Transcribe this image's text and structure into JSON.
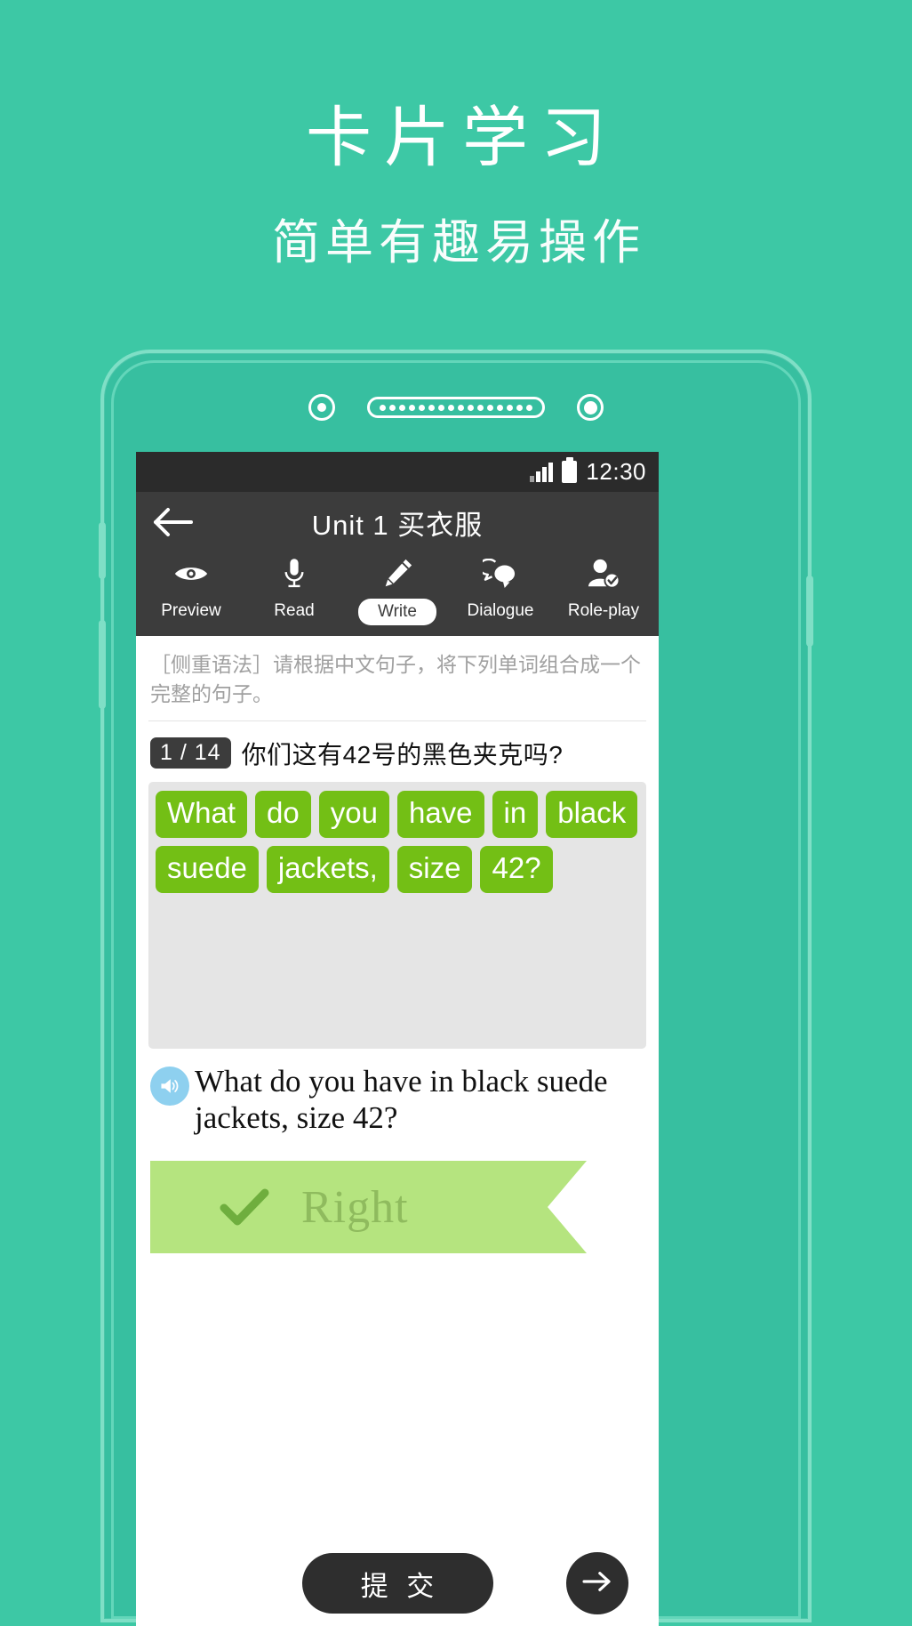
{
  "promo": {
    "title": "卡片学习",
    "subtitle": "简单有趣易操作"
  },
  "colors": {
    "background": "#3dc8a5",
    "tile_green": "#73bf15",
    "ribbon_green": "#b5e47f",
    "ribbon_text": "#8fbb5e",
    "speaker_blue": "#8ed0ef",
    "dark_bar": "#3c3c3c",
    "status_bar": "#2b2b2b"
  },
  "statusbar": {
    "time": "12:30",
    "signal_icon": "signal-bars-icon",
    "battery_icon": "battery-icon"
  },
  "titlebar": {
    "back_icon": "back-arrow-icon",
    "title": "Unit 1 买衣服"
  },
  "tabs": [
    {
      "label": "Preview",
      "icon": "eye-icon",
      "active": false
    },
    {
      "label": "Read",
      "icon": "microphone-icon",
      "active": false
    },
    {
      "label": "Write",
      "icon": "pencil-icon",
      "active": true
    },
    {
      "label": "Dialogue",
      "icon": "speech-bubbles-icon",
      "active": false
    },
    {
      "label": "Role-play",
      "icon": "person-check-icon",
      "active": false
    }
  ],
  "content": {
    "instruction": "［侧重语法］请根据中文句子，将下列单词组合成一个完整的句子。",
    "question_badge": "1 / 14",
    "question_text": "你们这有42号的黑色夹克吗?",
    "word_tiles": [
      "What",
      "do",
      "you",
      "have",
      "in",
      "black",
      "suede",
      "jackets,",
      "size",
      "42?"
    ],
    "speaker_icon": "speaker-icon",
    "answer_sentence": "What do you have in black suede jackets, size 42?",
    "result": {
      "check_icon": "check-icon",
      "label": "Right"
    }
  },
  "bottombar": {
    "submit_label": "提 交",
    "next_icon": "arrow-right-icon"
  },
  "phone": {
    "camera_icon": "camera-icon",
    "speaker_grille_icon": "speaker-grille-icon",
    "sensor_icon": "sensor-icon"
  }
}
